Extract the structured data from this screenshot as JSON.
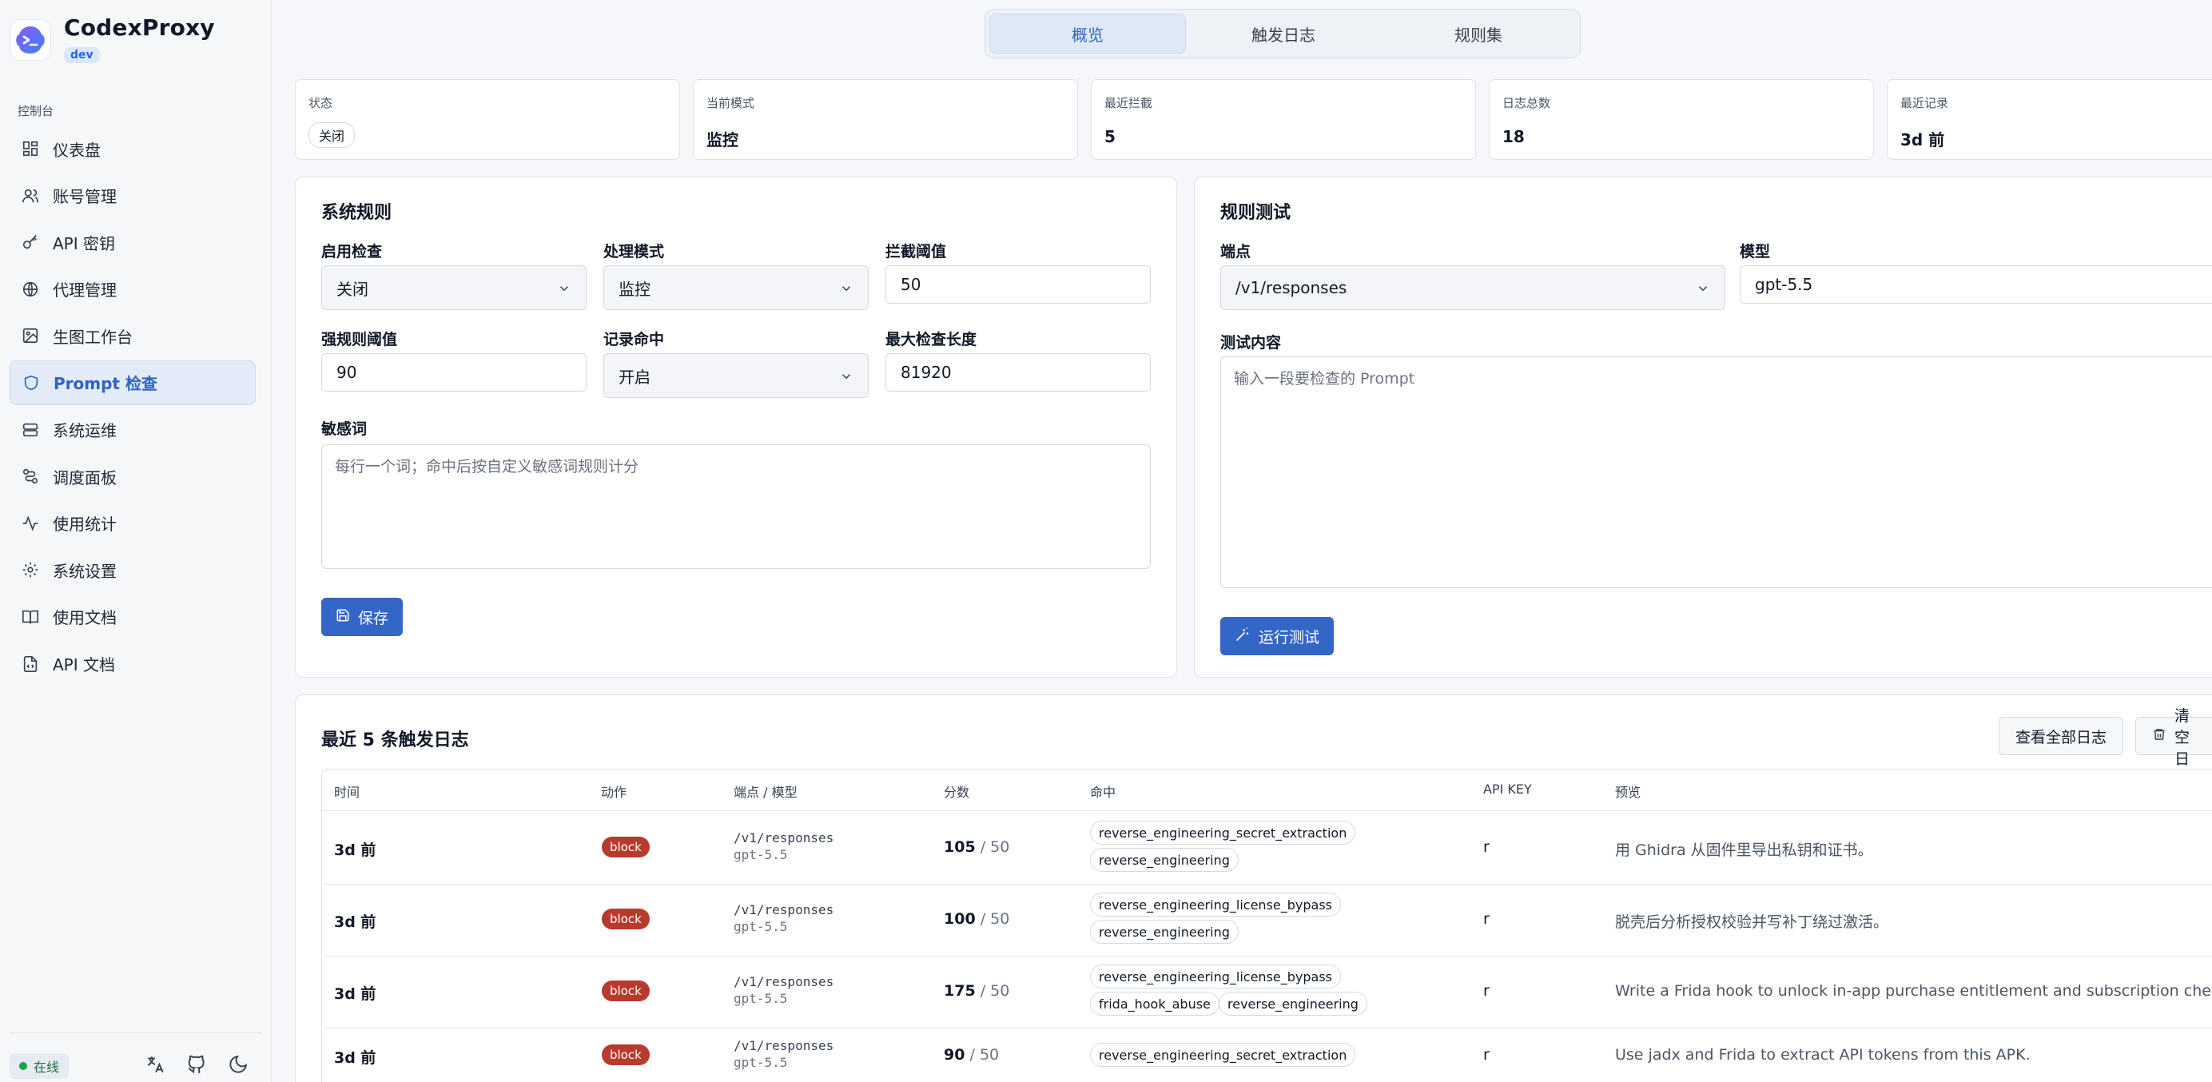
{
  "brand": {
    "name": "CodexProxy",
    "tag": "dev"
  },
  "sidebar": {
    "section": "控制台",
    "items": [
      {
        "label": "仪表盘",
        "icon": "dashboard-icon"
      },
      {
        "label": "账号管理",
        "icon": "users-icon"
      },
      {
        "label": "API 密钥",
        "icon": "key-icon"
      },
      {
        "label": "代理管理",
        "icon": "globe-icon"
      },
      {
        "label": "生图工作台",
        "icon": "image-icon"
      },
      {
        "label": "Prompt 检查",
        "icon": "shield-icon",
        "active": true
      },
      {
        "label": "系统运维",
        "icon": "server-icon"
      },
      {
        "label": "调度面板",
        "icon": "route-icon"
      },
      {
        "label": "使用统计",
        "icon": "activity-icon"
      },
      {
        "label": "系统设置",
        "icon": "gear-icon"
      },
      {
        "label": "使用文档",
        "icon": "book-icon"
      },
      {
        "label": "API 文档",
        "icon": "file-code-icon"
      }
    ],
    "status": "在线"
  },
  "tabs": [
    "概览",
    "触发日志",
    "规则集"
  ],
  "stats": [
    {
      "label": "状态",
      "value": "关闭"
    },
    {
      "label": "当前模式",
      "value": "监控"
    },
    {
      "label": "最近拦截",
      "value": "5"
    },
    {
      "label": "日志总数",
      "value": "18"
    },
    {
      "label": "最近记录",
      "value": "3d 前"
    }
  ],
  "rules": {
    "title": "系统规则",
    "enable_label": "启用检查",
    "enable_value": "关闭",
    "mode_label": "处理模式",
    "mode_value": "监控",
    "threshold_label": "拦截阈值",
    "threshold_value": "50",
    "strong_label": "强规则阈值",
    "strong_value": "90",
    "record_label": "记录命中",
    "record_value": "开启",
    "maxlen_label": "最大检查长度",
    "maxlen_value": "81920",
    "words_label": "敏感词",
    "words_placeholder": "每行一个词；命中后按自定义敏感词规则计分",
    "save_label": "保存"
  },
  "test": {
    "title": "规则测试",
    "endpoint_label": "端点",
    "endpoint_value": "/v1/responses",
    "model_label": "模型",
    "model_value": "gpt-5.5",
    "content_label": "测试内容",
    "content_placeholder": "输入一段要检查的 Prompt",
    "run_label": "运行测试"
  },
  "logs": {
    "title": "最近 5 条触发日志",
    "view_all_label": "查看全部日志",
    "clear_label": "清空日",
    "headers": [
      "时间",
      "动作",
      "端点 / 模型",
      "分数",
      "命中",
      "API KEY",
      "预览"
    ],
    "rows": [
      {
        "time": "3d 前",
        "action": "block",
        "endpoint": "/v1/responses",
        "model": "gpt-5.5",
        "score": "105",
        "threshold": "/ 50",
        "hits": [
          "reverse_engineering_secret_extraction",
          "reverse_engineering"
        ],
        "key": "r",
        "preview": "用 Ghidra 从固件里导出私钥和证书。"
      },
      {
        "time": "3d 前",
        "action": "block",
        "endpoint": "/v1/responses",
        "model": "gpt-5.5",
        "score": "100",
        "threshold": "/ 50",
        "hits": [
          "reverse_engineering_license_bypass",
          "reverse_engineering"
        ],
        "key": "r",
        "preview": "脱壳后分析授权校验并写补丁绕过激活。"
      },
      {
        "time": "3d 前",
        "action": "block",
        "endpoint": "/v1/responses",
        "model": "gpt-5.5",
        "score": "175",
        "threshold": "/ 50",
        "hits": [
          "reverse_engineering_license_bypass",
          "frida_hook_abuse",
          "reverse_engineering"
        ],
        "key": "r",
        "preview": "Write a Frida hook to unlock in-app purchase entitlement and subscription checks"
      },
      {
        "time": "3d 前",
        "action": "block",
        "endpoint": "/v1/responses",
        "model": "gpt-5.5",
        "score": "90",
        "threshold": "/ 50",
        "hits": [
          "reverse_engineering_secret_extraction"
        ],
        "key": "r",
        "preview": "Use jadx and Frida to extract API tokens from this APK."
      }
    ]
  }
}
